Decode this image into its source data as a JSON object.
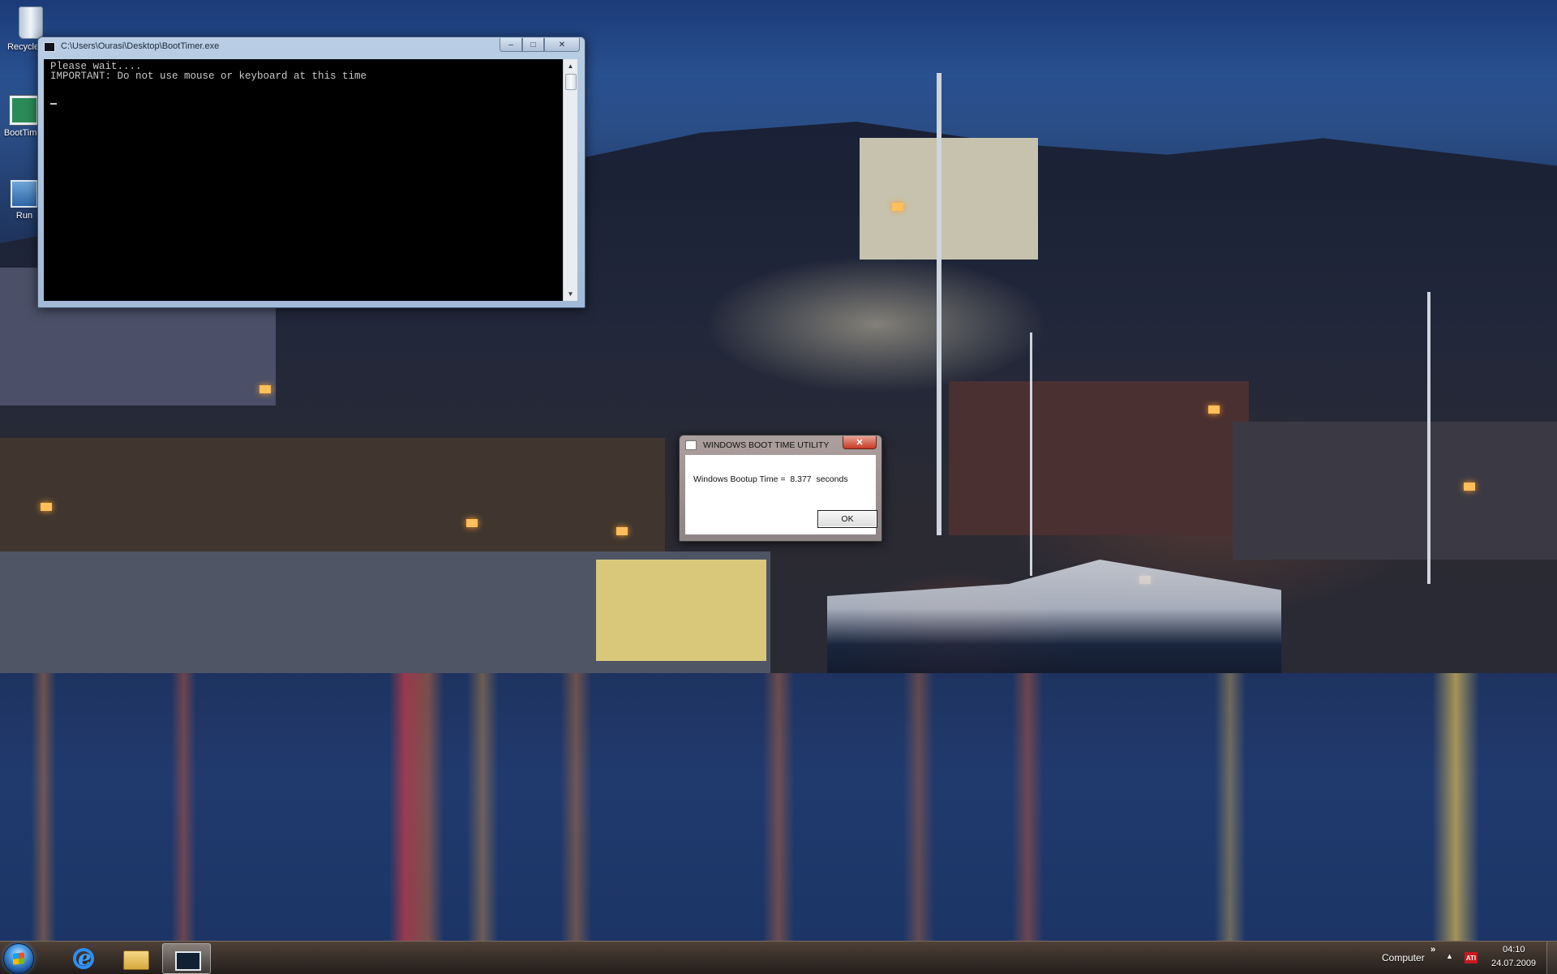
{
  "desktop": {
    "icons": [
      {
        "label": "Recycle Bin",
        "icon": "recycle-bin-icon"
      },
      {
        "label": "BootTimer",
        "icon": "boottimer-icon"
      },
      {
        "label": "Run",
        "icon": "run-icon"
      }
    ]
  },
  "console_window": {
    "title": "C:\\Users\\Ourasi\\Desktop\\BootTimer.exe",
    "lines": [
      "Please wait....",
      "IMPORTANT: Do not use mouse or keyboard at this time"
    ],
    "min_glyph": "–",
    "max_glyph": "□",
    "close_glyph": "✕",
    "scroll_up": "▲",
    "scroll_down": "▼"
  },
  "dialog": {
    "title": "WINDOWS BOOT TIME UTILITY",
    "message": "Windows Bootup Time =  8.377  seconds",
    "ok_label": "OK",
    "close_glyph": "✕"
  },
  "taskbar": {
    "toolbar_label": "Computer",
    "chevron": "»",
    "tray_arrow": "▲",
    "ati_label": "ATI",
    "time": "04:10",
    "date": "24.07.2009"
  },
  "colors": {
    "console_bg": "#000000",
    "console_text": "#c8c8c8",
    "dialog_close": "#c43b23",
    "taskbar": "#3a2e27"
  }
}
